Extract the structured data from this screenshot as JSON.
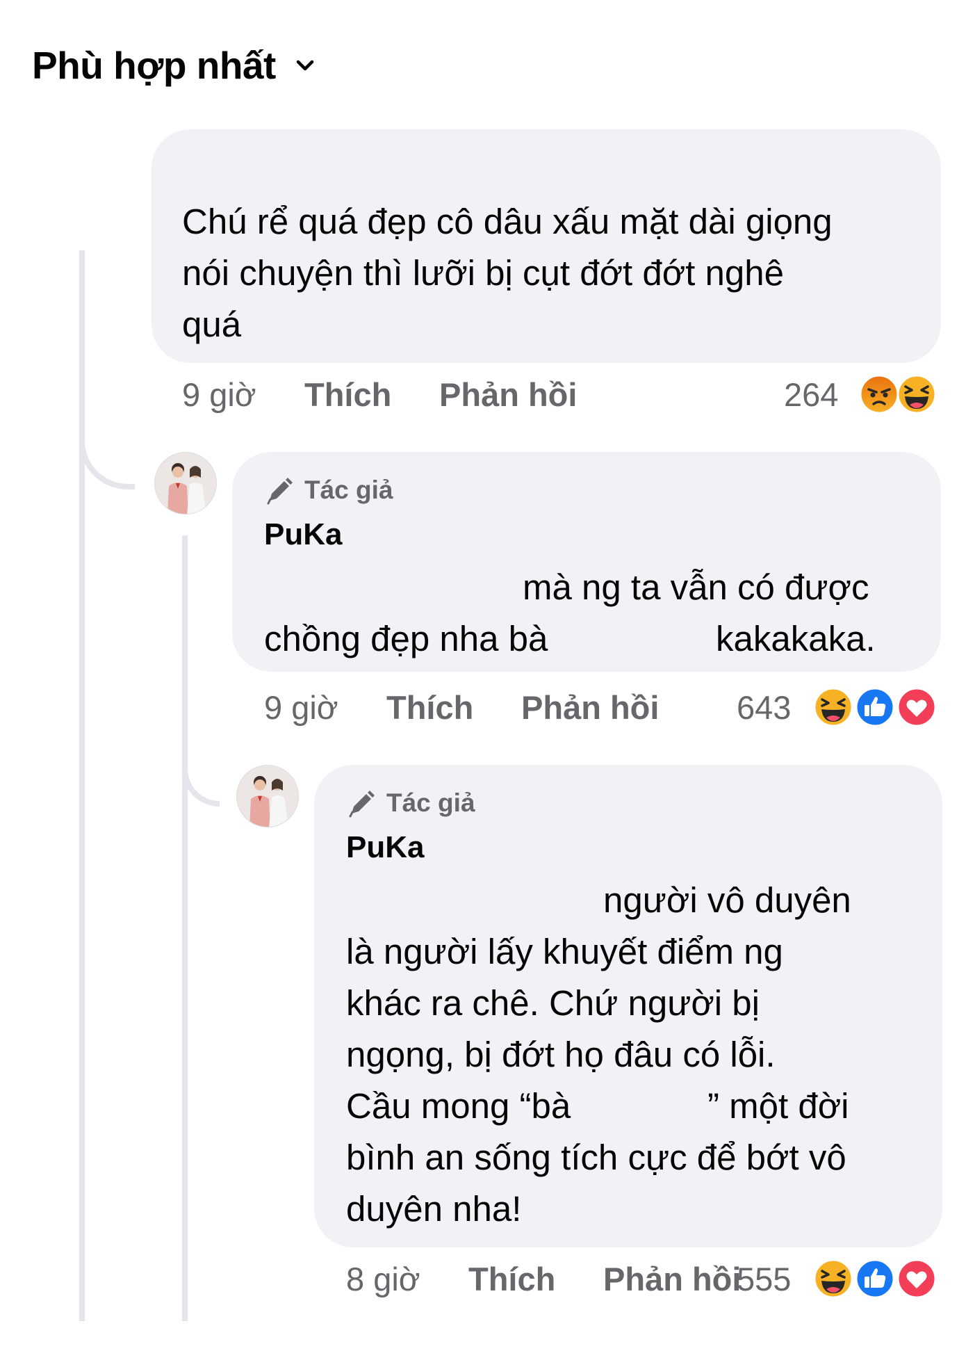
{
  "sort": {
    "label": "Phù hợp nhất",
    "icon": "chevron-down-icon"
  },
  "comments": [
    {
      "lines": [
        "Chú rể quá đẹp cô dâu xấu mặt dài giọng",
        "nói chuyện thì lưỡi bị cụt đớt đớt nghê",
        "quá"
      ],
      "time": "9 giờ",
      "like_label": "Thích",
      "reply_label": "Phản hồi",
      "reaction_count": "264",
      "reactions": [
        "angry",
        "haha"
      ]
    },
    {
      "badge": "Tác giả",
      "author": "PuKa",
      "lines": [
        "mà ng ta vẫn có được",
        "chồng đẹp nha bà",
        "kakakaka."
      ],
      "time": "9 giờ",
      "like_label": "Thích",
      "reply_label": "Phản hồi",
      "reaction_count": "643",
      "reactions": [
        "haha",
        "like",
        "love"
      ]
    },
    {
      "badge": "Tác giả",
      "author": "PuKa",
      "lines": [
        "người vô duyên",
        "là người lấy khuyết điểm ng",
        "khác ra chê. Chứ người bị",
        "ngọng, bị đớt họ đâu có lỗi.",
        "Cầu mong “bà",
        "” một đời",
        "bình an sống tích cực để bớt vô",
        "duyên nha!"
      ],
      "time": "8 giờ",
      "like_label": "Thích",
      "reply_label": "Phản hồi",
      "reaction_count": "555",
      "reactions": [
        "haha",
        "like",
        "love"
      ]
    }
  ],
  "colors": {
    "bubble": "#f0f2f5",
    "meta_text": "#65676b",
    "like_blue": "#1877f2",
    "love_red": "#f33e58",
    "haha_yellow": "#f7b125",
    "angry_orange": "#e9710f"
  }
}
